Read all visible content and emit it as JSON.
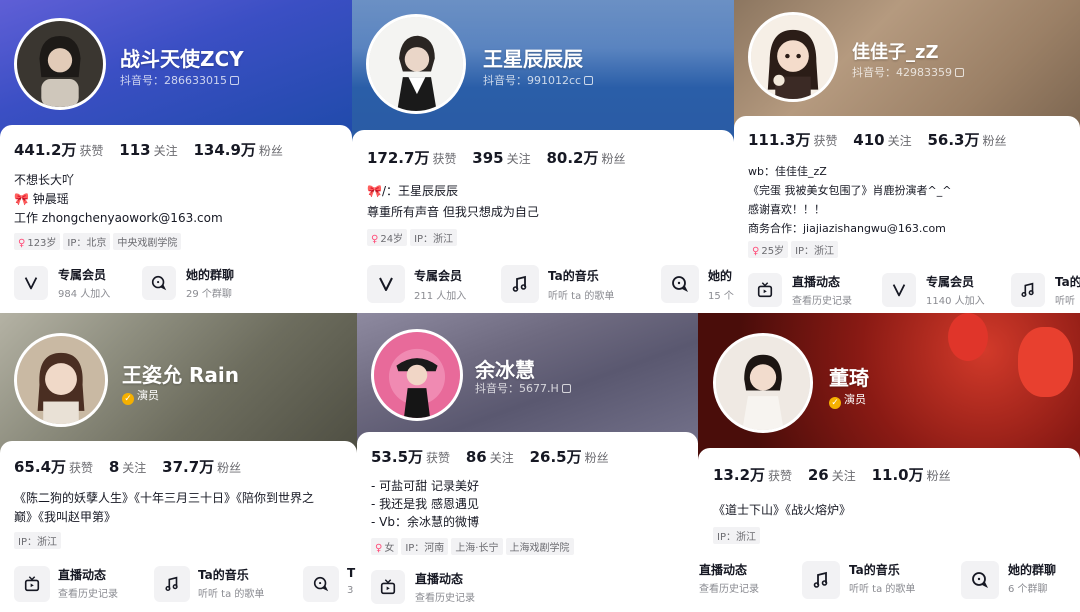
{
  "p1": {
    "name": "战斗天使ZCY",
    "douyin_id": "抖音号：286633015",
    "likes": "441.2万",
    "likes_label": "获赞",
    "following": "113",
    "following_label": "关注",
    "fans": "134.9万",
    "fans_label": "粉丝",
    "bio": [
      "不想长大吖",
      "钟晨瑶",
      "工作 zhongchenyaowork@163.com"
    ],
    "tags": [
      "123岁",
      "IP：北京",
      "中央戏剧学院"
    ],
    "features": [
      {
        "title": "专属会员",
        "sub": "984 人加入",
        "icon": "v-icon"
      },
      {
        "title": "她的群聊",
        "sub": "29 个群聊",
        "icon": "chat-icon"
      }
    ]
  },
  "p2": {
    "name": "王星辰辰辰",
    "douyin_id": "抖音号：991012cc",
    "likes": "172.7万",
    "likes_label": "获赞",
    "following": "395",
    "following_label": "关注",
    "fans": "80.2万",
    "fans_label": "粉丝",
    "bio": [
      "/：王星辰辰辰",
      "尊重所有声音 但我只想成为自己"
    ],
    "tags": [
      "24岁",
      "IP：浙江"
    ],
    "features": [
      {
        "title": "专属会员",
        "sub": "211 人加入",
        "icon": "v-icon"
      },
      {
        "title": "Ta的音乐",
        "sub": "听听 ta 的歌单",
        "icon": "music-icon"
      },
      {
        "title": "她的",
        "sub": "15 个",
        "icon": "chat-icon"
      }
    ]
  },
  "p3": {
    "name": "佳佳子_zZ",
    "douyin_id": "抖音号：42983359",
    "likes": "111.3万",
    "likes_label": "获赞",
    "following": "410",
    "following_label": "关注",
    "fans": "56.3万",
    "fans_label": "粉丝",
    "bio": [
      "wb：佳佳佳_zZ",
      "《完蛋 我被美女包围了》肖鹿扮演者^_^",
      "感谢喜欢！！！",
      "商务合作：jiajiazishangwu@163.com"
    ],
    "tags": [
      "25岁",
      "IP：浙江"
    ],
    "features": [
      {
        "title": "直播动态",
        "sub": "查看历史记录",
        "icon": "live-icon"
      },
      {
        "title": "专属会员",
        "sub": "1140 人加入",
        "icon": "v-icon"
      },
      {
        "title": "Ta的",
        "sub": "听听",
        "icon": "music-icon"
      }
    ]
  },
  "p4": {
    "name": "王姿允 Rain",
    "verified": "演员",
    "likes": "65.4万",
    "likes_label": "获赞",
    "following": "8",
    "following_label": "关注",
    "fans": "37.7万",
    "fans_label": "粉丝",
    "bio": [
      "《陈二狗的妖孽人生》《十年三月三十日》《陪你到世界之",
      "巅》《我叫赵甲第》"
    ],
    "tags": [
      "IP：浙江"
    ],
    "features": [
      {
        "title": "直播动态",
        "sub": "查看历史记录",
        "icon": "live-icon"
      },
      {
        "title": "Ta的音乐",
        "sub": "听听 ta 的歌单",
        "icon": "music-icon"
      },
      {
        "title": "T",
        "sub": "3",
        "icon": "chat-icon"
      }
    ]
  },
  "p5": {
    "name": "余冰慧",
    "douyin_id": "抖音号：5677.H",
    "likes": "53.5万",
    "likes_label": "获赞",
    "following": "86",
    "following_label": "关注",
    "fans": "26.5万",
    "fans_label": "粉丝",
    "bio": [
      "- 可盐可甜 记录美好",
      "- 我还是我 感恩遇见",
      "- Vb：余冰慧的微博"
    ],
    "tags": [
      "女",
      "IP：河南",
      "上海·长宁",
      "上海戏剧学院"
    ],
    "features": [
      {
        "title": "直播动态",
        "sub": "查看历史记录",
        "icon": "live-icon"
      }
    ]
  },
  "p6": {
    "name": "董琦",
    "verified": "演员",
    "likes": "13.2万",
    "likes_label": "获赞",
    "following": "26",
    "following_label": "关注",
    "fans": "11.0万",
    "fans_label": "粉丝",
    "bio": [
      "《道士下山》《战火熔炉》"
    ],
    "tags": [
      "IP：浙江"
    ],
    "features": [
      {
        "title": "直播动态",
        "sub": "查看历史记录",
        "icon": "none"
      },
      {
        "title": "Ta的音乐",
        "sub": "听听 ta 的歌单",
        "icon": "music-icon"
      },
      {
        "title": "她的群聊",
        "sub": "6 个群聊",
        "icon": "chat-icon"
      }
    ]
  }
}
